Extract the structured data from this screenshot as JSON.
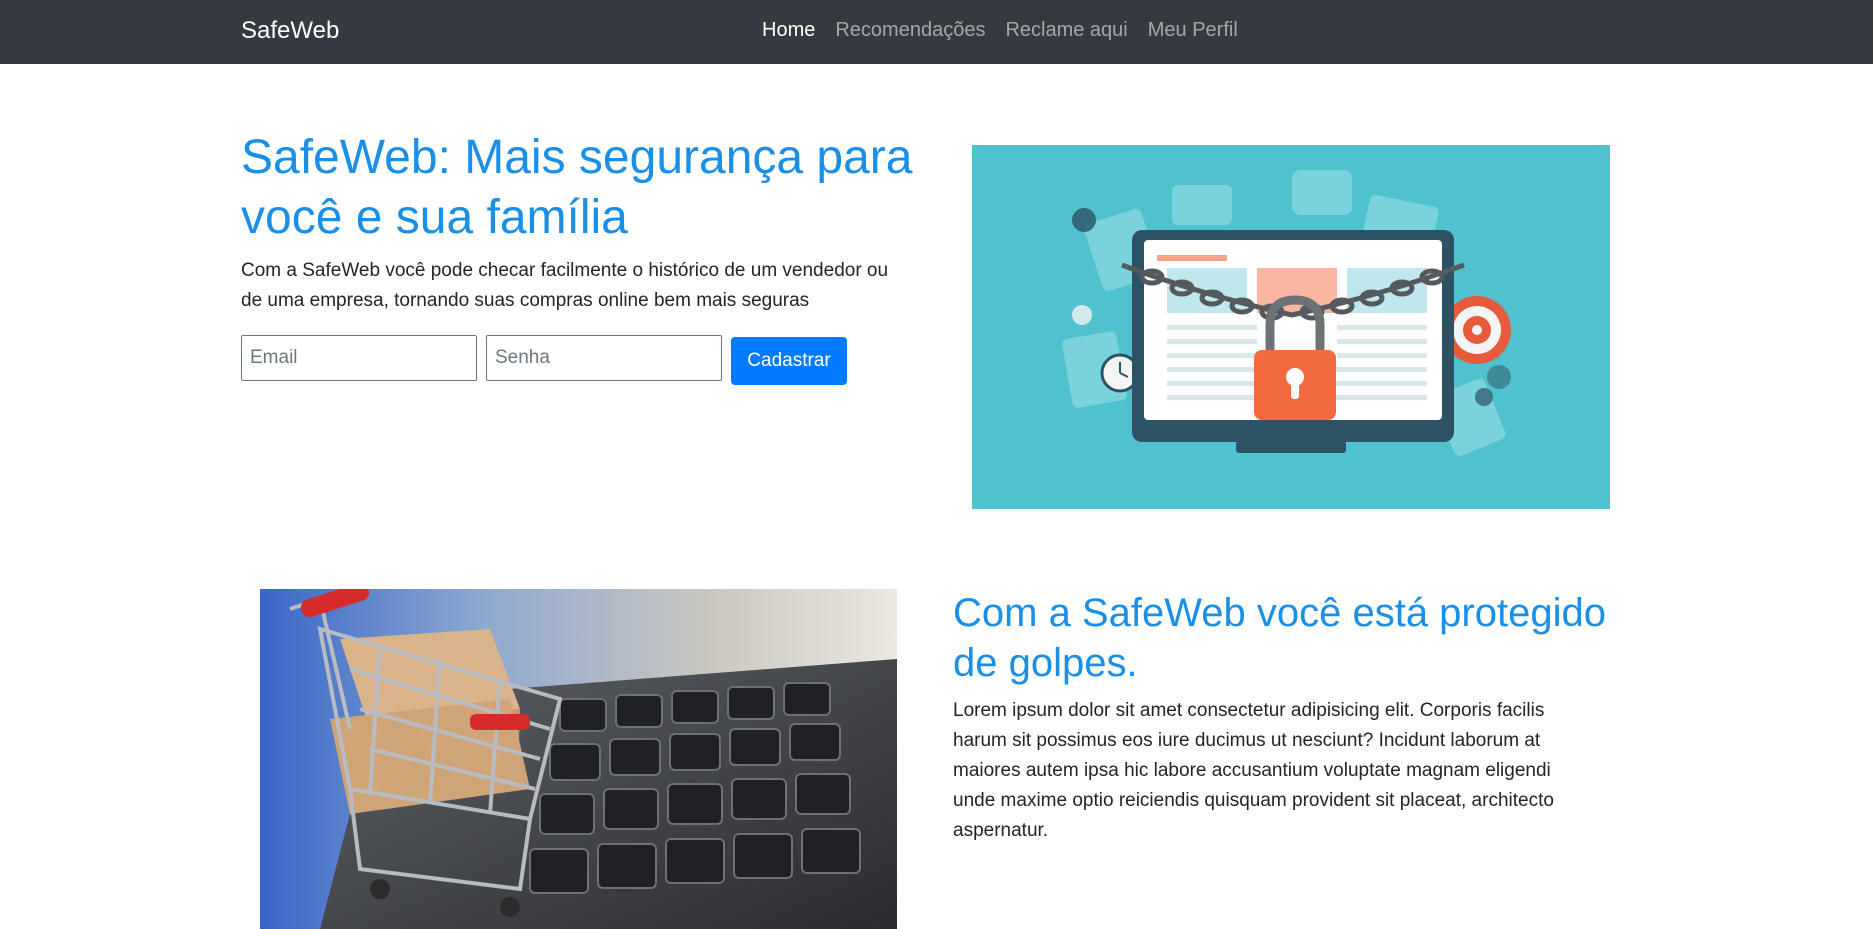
{
  "navbar": {
    "brand": "SafeWeb",
    "links": [
      {
        "label": "Home",
        "active": true
      },
      {
        "label": "Recomendações",
        "active": false
      },
      {
        "label": "Reclame aqui",
        "active": false
      },
      {
        "label": "Meu Perfil",
        "active": false
      }
    ]
  },
  "hero": {
    "title": "SafeWeb: Mais segurança para você e sua família",
    "text": "Com a SafeWeb você pode checar facilmente o histórico de um vendedor ou de uma empresa, tornando suas compras online bem mais seguras",
    "email_placeholder": "Email",
    "password_placeholder": "Senha",
    "submit_label": "Cadastrar"
  },
  "section": {
    "title": "Com a SafeWeb você está protegido de golpes.",
    "text": "Lorem ipsum dolor sit amet consectetur adipisicing elit. Corporis facilis harum sit possimus eos iure ducimus ut nesciunt? Incidunt laborum at maiores autem ipsa hic labore accusantium voluptate magnam eligendi unde maxime optio reiciendis quisquam provident sit placeat, architecto aspernatur."
  },
  "colors": {
    "navbar_bg": "#343a40",
    "heading_blue": "#1a8fe8",
    "button_blue": "#007bff",
    "illustration_bg": "#4fc1cf",
    "lock_orange": "#f26a3d"
  },
  "icons": [
    "lock-icon",
    "chain-icon",
    "monitor-icon",
    "shopping-cart-icon",
    "package-box-icon"
  ]
}
